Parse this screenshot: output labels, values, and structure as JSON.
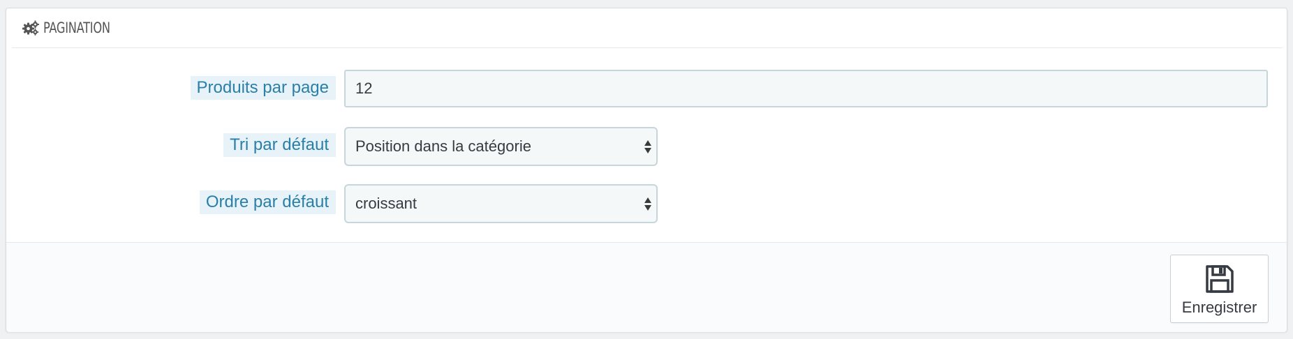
{
  "panel": {
    "title": "PAGINATION",
    "icon": "gears-icon"
  },
  "form": {
    "products_per_page": {
      "label": "Produits par page",
      "value": "12"
    },
    "default_sort": {
      "label": "Tri par défaut",
      "selected": "Position dans la catégorie"
    },
    "default_order": {
      "label": "Ordre par défaut",
      "selected": "croissant"
    }
  },
  "footer": {
    "save_label": "Enregistrer",
    "save_icon": "floppy-disk-icon"
  },
  "colors": {
    "label_text": "#2a7fa8",
    "label_bg": "#e7f3f8",
    "input_bg": "#f5f8f9",
    "input_border": "#c7d6db"
  }
}
